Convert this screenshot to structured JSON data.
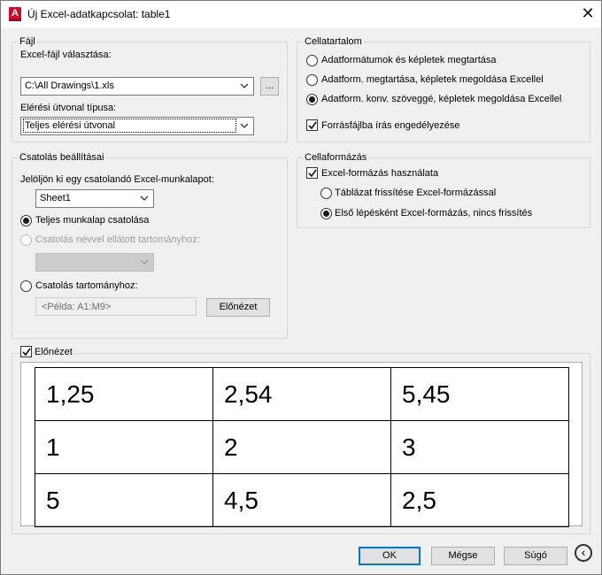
{
  "window": {
    "title": "Új Excel-adatkapcsolat: table1",
    "app_icon_letter": "A",
    "close_glyph": "✕"
  },
  "file_group": {
    "title": "Fájl",
    "select_label": "Excel-fájl választása:",
    "file_path": "C:\\All Drawings\\1.xls",
    "browse_label": "...",
    "path_type_label": "Elérési útvonal típusa:",
    "path_type_value": "Teljes elérési útvonal"
  },
  "cell_content": {
    "title": "Cellatartalom",
    "options": [
      {
        "label": "Adatformátumok és képletek megtartása",
        "selected": false
      },
      {
        "label": "Adatform. megtartása, képletek megoldása Excellel",
        "selected": false
      },
      {
        "label": "Adatform. konv. szöveggé, képletek megoldása Excellel",
        "selected": true
      }
    ],
    "allow_write_label": "Forrásfájlba írás engedélyezése",
    "allow_write_checked": true
  },
  "link_settings": {
    "title": "Csatolás beállításai",
    "sheet_label": "Jelöljön ki egy csatolandó Excel-munkalapot:",
    "sheet_value": "Sheet1",
    "option_full_sheet": "Teljes munkalap csatolása",
    "option_named_range": "Csatolás névvel ellátott tartományhoz:",
    "named_range_value": "",
    "option_range": "Csatolás tartományhoz:",
    "range_placeholder": "<Példa: A1:M9>",
    "preview_button": "Előnézet",
    "selected_option": "full_sheet"
  },
  "cell_format": {
    "title": "Cellaformázás",
    "use_excel_label": "Excel-formázás használata",
    "use_excel_checked": true,
    "options": [
      {
        "label": "Táblázat frissítése Excel-formázással",
        "selected": false
      },
      {
        "label": "Első lépésként Excel-formázás, nincs frissítés",
        "selected": true
      }
    ]
  },
  "preview": {
    "label": "Előnézet",
    "checked": true,
    "rows": [
      [
        "1,25",
        "2,54",
        "5,45"
      ],
      [
        "1",
        "2",
        "3"
      ],
      [
        "5",
        "4,5",
        "2,5"
      ]
    ]
  },
  "footer": {
    "ok": "OK",
    "cancel": "Mégse",
    "help": "Súgó",
    "back_glyph": "‹"
  }
}
